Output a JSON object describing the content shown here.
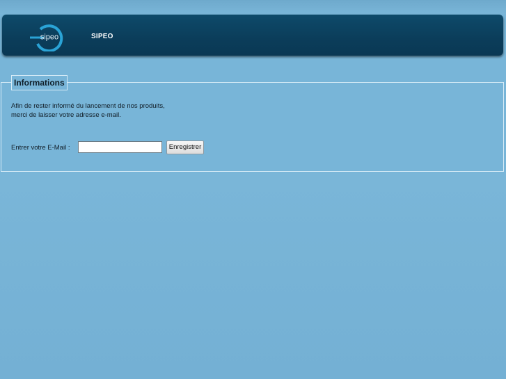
{
  "header": {
    "logo_text": "sipeo",
    "brand": "SIPEO"
  },
  "panel": {
    "legend": "Informations",
    "line1": "Afin de rester informé du lancement de nos produits,",
    "line2": "merci de laisser votre adresse e-mail.",
    "email_label": "Entrer votre E-Mail :",
    "email_value": "",
    "submit_label": "Enregistrer"
  },
  "colors": {
    "page_bg": "#78b5d8",
    "header_bg": "#0b3d5a",
    "logo_accent": "#2aa3d6"
  }
}
